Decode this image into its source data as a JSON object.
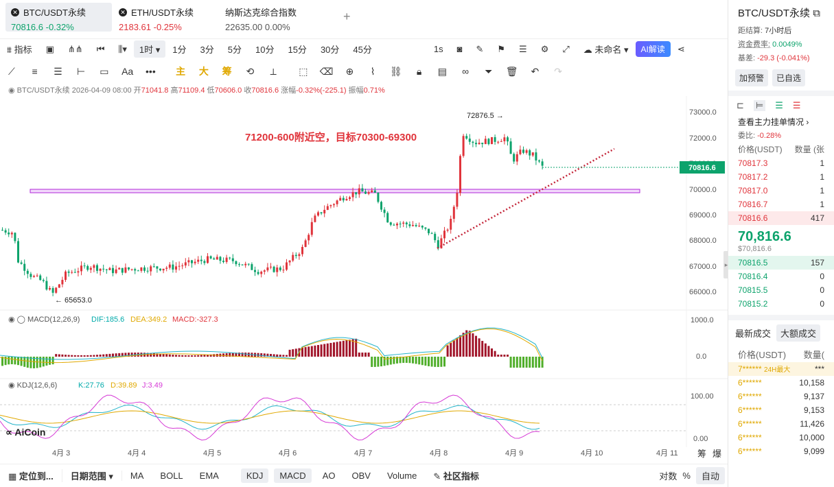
{
  "tickers": [
    {
      "name": "BTC/USDT永续",
      "price": "70816.6",
      "change": "-0.32%"
    },
    {
      "name": "ETH/USDT永续",
      "price": "2183.61",
      "change": "-0.25%"
    },
    {
      "name": "纳斯达克综合指数",
      "price": "22635.00",
      "change": "0.00%"
    }
  ],
  "add_tab": "+",
  "toolbar": {
    "indicator": "指标",
    "interval_selected": "1时",
    "intervals": [
      "1分",
      "3分",
      "5分",
      "10分",
      "15分",
      "30分",
      "45分"
    ],
    "seconds": "1s",
    "layout_name": "未命名",
    "ai_label": "AI解读"
  },
  "draw_tools": {
    "main": "主",
    "big": "大",
    "chip": "筹",
    "text": "Aa"
  },
  "info_line": {
    "symbol": "BTC/USDT永续",
    "datetime": "2026-04-09 08:00",
    "open_label": "开",
    "open": "71041.8",
    "high_label": "高",
    "high": "71109.4",
    "low_label": "低",
    "low": "70606.0",
    "close_label": "收",
    "close": "70816.6",
    "change_label": "涨幅",
    "change": "-0.32%(-225.1)",
    "amp_label": "振幅",
    "amp": "0.71%"
  },
  "annotation": "71200-600附近空，目标70300-69300",
  "high_marker": "72876.5 →",
  "low_marker": "← 65653.0",
  "current_price_tag": "70816.6",
  "y_ticks": [
    "73000.0",
    "72000.0",
    "71000.0",
    "70000.0",
    "69000.0",
    "68000.0",
    "67000.0",
    "66000.0"
  ],
  "macd_legend": {
    "name": "MACD(12,26,9)",
    "dif": "DIF:185.6",
    "dea": "DEA:349.2",
    "macd": "MACD:-327.3"
  },
  "macd_ticks": [
    "1000.0",
    "0.0"
  ],
  "kdj_legend": {
    "name": "KDJ(12,6,6)",
    "k": "K:27.76",
    "d": "D:39.89",
    "j": "J:3.49"
  },
  "kdj_ticks": [
    "100.00",
    "0.00"
  ],
  "x_ticks": [
    "4月 3",
    "4月 4",
    "4月 5",
    "4月 6",
    "4月 7",
    "4月 8",
    "4月 9",
    "4月 10",
    "4月 11"
  ],
  "axis_corner": [
    "筹",
    "爆"
  ],
  "logo": "AiCoin",
  "bottom": {
    "locate": "定位到...",
    "range": "日期范围",
    "main_inds": [
      "MA",
      "BOLL",
      "EMA"
    ],
    "sub_inds": [
      "KDJ",
      "MACD",
      "AO",
      "OBV",
      "Volume"
    ],
    "community": "社区指标",
    "log": "对数",
    "pct": "%",
    "auto": "自动"
  },
  "colors": {
    "up": "#e0343b",
    "down": "#0da36c",
    "band": "#b026d8",
    "annotation": "#e0343b"
  },
  "right_panel": {
    "title": "BTC/USDT永续",
    "settle_label": "距结算:",
    "settle": "7小时后",
    "funding_label": "资金费率:",
    "funding": "0.0049%",
    "basis_label": "基差:",
    "basis": "-29.3 (-0.041%)",
    "buttons": [
      "加预警",
      "已自选"
    ],
    "depth_title": "查看主力挂单情况",
    "ratio_label": "委比:",
    "ratio": "-0.28%",
    "ask_header": [
      "价格(USDT)",
      "数量 (张"
    ],
    "asks": [
      {
        "p": "70817.3",
        "q": "1"
      },
      {
        "p": "70817.2",
        "q": "1"
      },
      {
        "p": "70817.0",
        "q": "1"
      },
      {
        "p": "70816.7",
        "q": "1"
      },
      {
        "p": "70816.6",
        "q": "417"
      }
    ],
    "last_price": "70,816.6",
    "last_price_usd": "$70,816.6",
    "bids": [
      {
        "p": "70816.5",
        "q": "157"
      },
      {
        "p": "70816.4",
        "q": "0"
      },
      {
        "p": "70815.5",
        "q": "0"
      },
      {
        "p": "70815.2",
        "q": "0"
      }
    ],
    "trades_tabs": [
      "最新成交",
      "大额成交"
    ],
    "trades_header": [
      "价格(USDT)",
      "数量("
    ],
    "trades": [
      {
        "p": "7******",
        "tag": "24H最大",
        "q": "***"
      },
      {
        "p": "6******",
        "tag": "",
        "q": "10,158"
      },
      {
        "p": "6******",
        "tag": "",
        "q": "9,137"
      },
      {
        "p": "6******",
        "tag": "",
        "q": "9,153"
      },
      {
        "p": "6******",
        "tag": "",
        "q": "11,426"
      },
      {
        "p": "6******",
        "tag": "",
        "q": "10,000"
      },
      {
        "p": "6******",
        "tag": "",
        "q": "9,099"
      }
    ]
  }
}
